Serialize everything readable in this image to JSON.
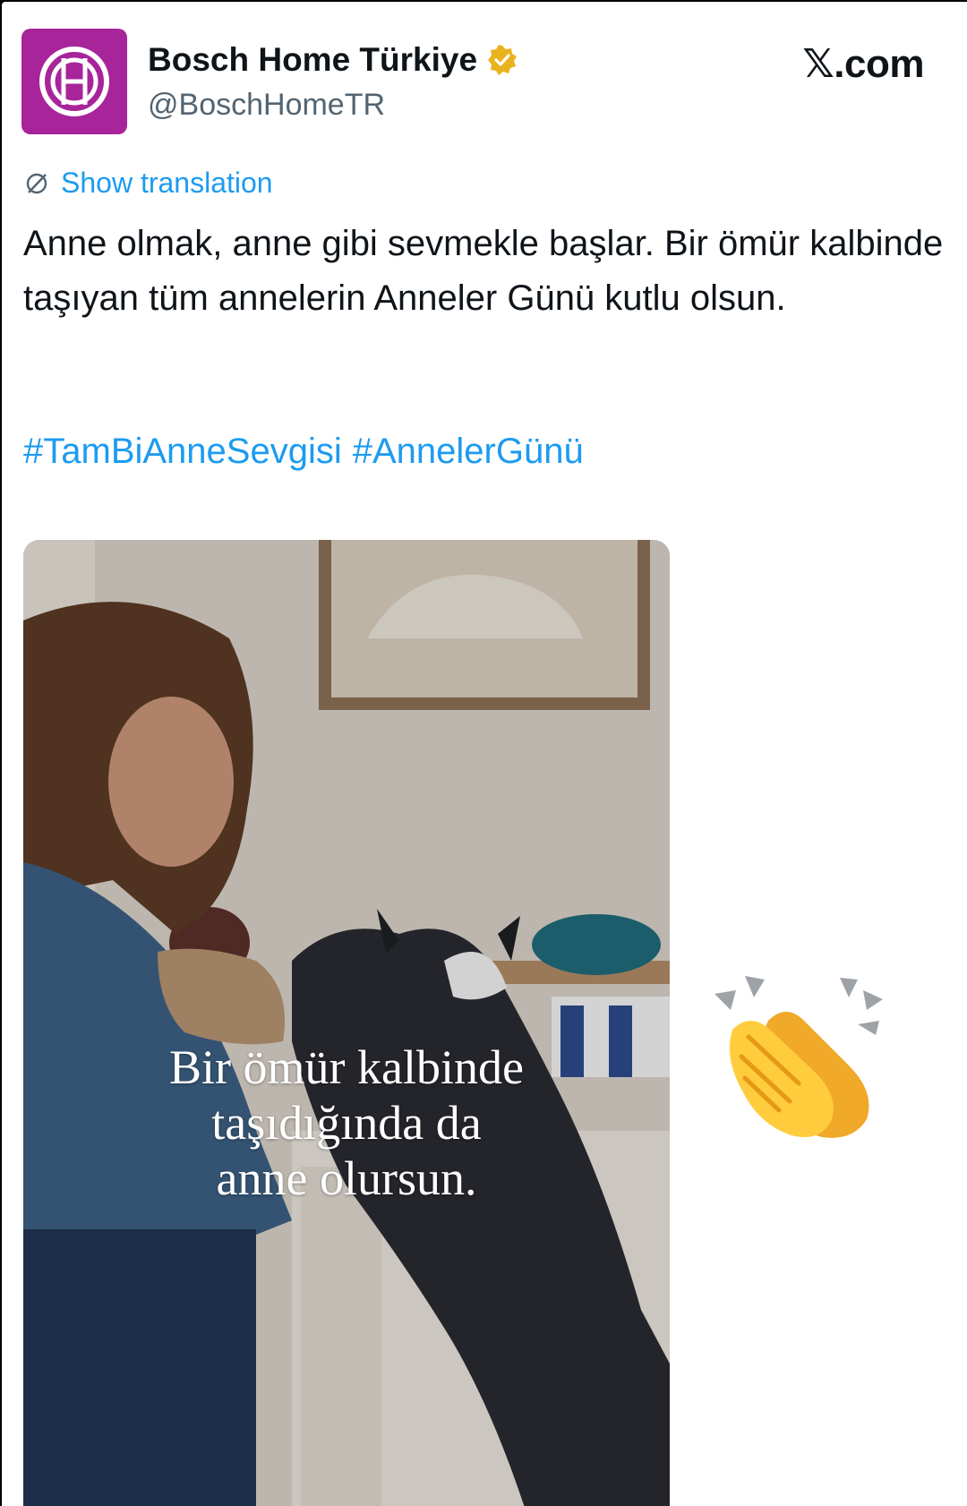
{
  "account": {
    "name": "Bosch Home Türkiye",
    "handle": "@BoschHomeTR",
    "verified_icon": "verified-badge-gold",
    "avatar_icon": "bosch-logo",
    "brand_color": "#a8249a"
  },
  "source": {
    "site_label": "𝕏.com"
  },
  "translation": {
    "label": "Show translation",
    "icon": "translate-globe-icon"
  },
  "post": {
    "text": "Anne olmak, anne gibi sevmekle başlar. Bir ömür kalbinde taşıyan tüm annelerin Anneler Günü kutlu olsun.",
    "hashtags": [
      "#TamBiAnneSevgisi",
      "#AnnelerGünü"
    ]
  },
  "media": {
    "caption_lines": [
      "Bir ömür kalbinde",
      "taşıdığında da",
      "anne olursun."
    ]
  },
  "reaction": {
    "emoji_icon": "clapping-hands-icon"
  },
  "colors": {
    "link": "#1d9bf0",
    "text": "#0f1419",
    "muted": "#536471",
    "verified": "#e8b31c"
  }
}
